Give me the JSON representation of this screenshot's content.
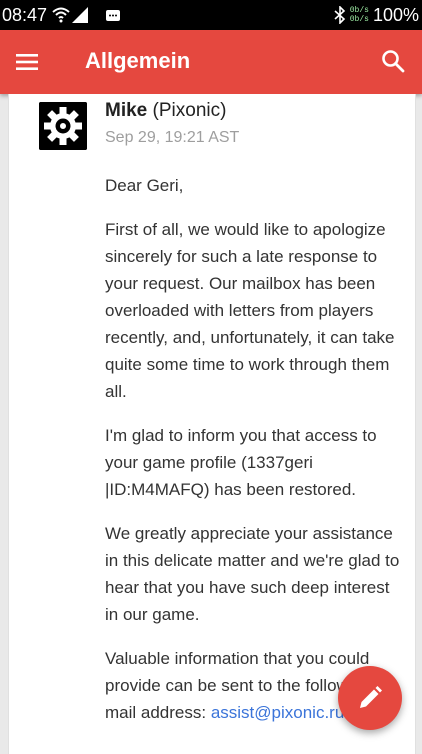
{
  "status_bar": {
    "time": "08:47",
    "net_speed_up": "0b/s",
    "net_speed_down": "0b/s",
    "battery": "100%"
  },
  "app_bar": {
    "title": "Allgemein",
    "menu_icon": "menu-icon",
    "search_icon": "search-icon",
    "color": "#e5483f"
  },
  "message": {
    "sender_name": "Mike",
    "sender_org": "(Pixonic)",
    "timestamp": "Sep 29, 19:21 AST",
    "greeting": "Dear Geri,",
    "paragraphs": [
      "First of all, we would like to apologize sincerely for such a late response to your request. Our mailbox has been overloaded with letters from players recently, and, unfortunately, it can take quite some time to work through them all.",
      "I'm glad to inform you that access to your game profile (1337geri |ID:M4MAFQ) has been restored.",
      "We greatly appreciate your assistance in this delicate matter and we're glad to hear that you have such deep interest in our game."
    ],
    "last_paragraph_start": "Valuable information that you could provide can be sent to the following e-mail address: ",
    "email": "assist@pixonic.ru"
  },
  "fab": {
    "icon": "pencil-icon"
  }
}
